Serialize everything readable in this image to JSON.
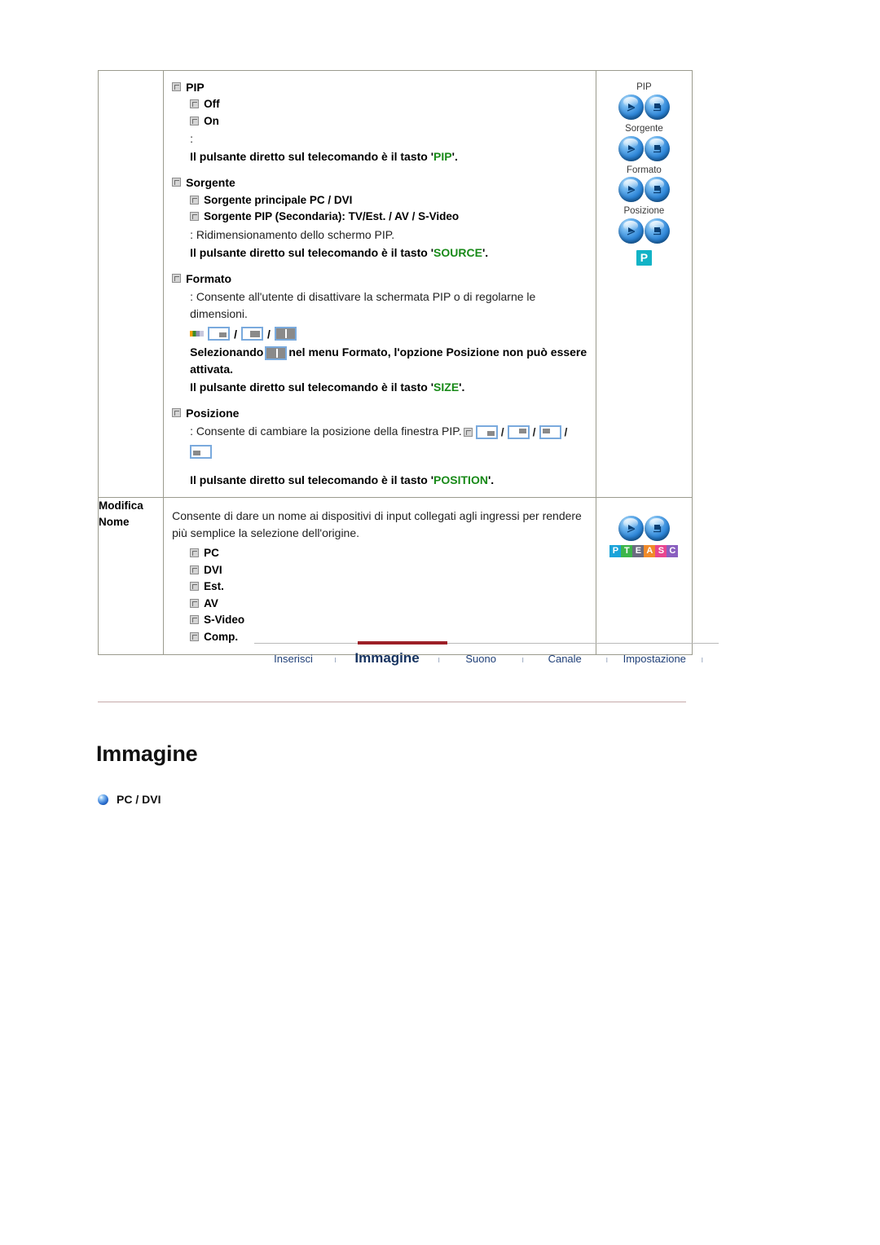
{
  "spec_table": {
    "rows": [
      {
        "label": "",
        "groups": [
          {
            "heading": "PIP",
            "sub_items": [
              "Off",
              "On"
            ],
            "plain_lines": [
              ":"
            ],
            "bold_notes": [
              {
                "pre": "Il pulsante diretto sul telecomando è il tasto '",
                "key": "PIP",
                "post": "'."
              }
            ]
          },
          {
            "heading": "Sorgente",
            "sub_items": [
              "Sorgente principale PC / DVI",
              "Sorgente PIP (Secondaria): TV/Est. / AV / S-Video"
            ],
            "plain_lines": [
              ": Ridimensionamento dello schermo PIP."
            ],
            "bold_notes": [
              {
                "pre": "Il pulsante diretto sul telecomando è il tasto '",
                "key": "SOURCE",
                "post": "'."
              }
            ]
          },
          {
            "heading": "Formato",
            "sub_items": [],
            "plain_lines": [
              ": Consente all'utente di disattivare la schermata PIP o di regolarne le dimensioni."
            ],
            "pictograms": [
              "colorbar",
              "frame-br",
              "slash",
              "frame-br2",
              "slash",
              "frame-split"
            ],
            "selecting_note": {
              "pre": "Selezionando",
              "icon": "frame-split",
              "post": "nel menu Formato, l'opzione Posizione non può essere attivata."
            },
            "bold_notes": [
              {
                "pre": "Il pulsante diretto sul telecomando è il tasto '",
                "key": "SIZE",
                "post": "'."
              }
            ]
          },
          {
            "heading": "Posizione",
            "sub_items": [],
            "position_line": {
              "text": ": Consente di cambiare la posizione della finestra PIP.",
              "icons": [
                "mini-marker",
                "frame-br",
                "slash",
                "frame-tr",
                "slash",
                "frame-tl",
                "slash"
              ],
              "wrapped_icon": "frame-bl"
            },
            "bold_notes": [
              {
                "pre": "Il pulsante diretto sul telecomando è il tasto '",
                "key": "POSITION",
                "post": "'."
              }
            ]
          }
        ],
        "image_col": {
          "button_groups": [
            {
              "label": "PIP"
            },
            {
              "label": "Sorgente"
            },
            {
              "label": "Formato"
            },
            {
              "label": "Posizione"
            }
          ],
          "badge": "P"
        }
      },
      {
        "label": "Modifica Nome",
        "label_lines": [
          "Modifica",
          "Nome"
        ],
        "intro": "Consente di dare un nome ai dispositivi di input collegati agli ingressi per rendere più semplice la selezione dell'origine.",
        "sub_items": [
          "PC",
          "DVI",
          "Est.",
          "AV",
          "S-Video",
          "Comp."
        ],
        "image_col": {
          "pteasc": [
            {
              "letter": "P",
              "color": "#1aa3d9"
            },
            {
              "letter": "T",
              "color": "#3cb54a"
            },
            {
              "letter": "E",
              "color": "#6b6b80"
            },
            {
              "letter": "A",
              "color": "#f08a2a"
            },
            {
              "letter": "S",
              "color": "#e8458f"
            },
            {
              "letter": "C",
              "color": "#8a5fc0"
            }
          ]
        }
      }
    ]
  },
  "bottom_nav": {
    "items": [
      {
        "label": "Inserisci",
        "active": false
      },
      {
        "label": "Immagine",
        "active": true
      },
      {
        "label": "Suono",
        "active": false
      },
      {
        "label": "Canale",
        "active": false
      },
      {
        "label": "Impostazione",
        "active": false
      }
    ],
    "separator": "ı",
    "accent_color": "#9c1f27"
  },
  "page": {
    "title": "Immagine",
    "sub_item_label": "PC / DVI"
  }
}
